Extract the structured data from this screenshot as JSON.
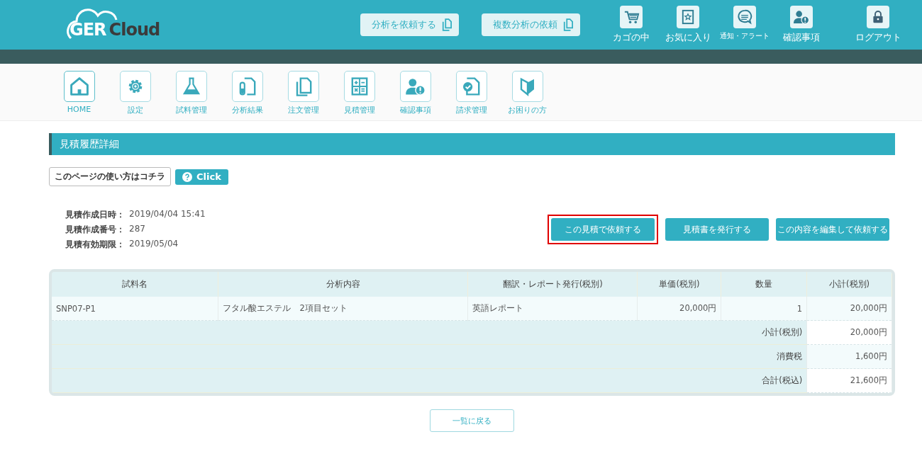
{
  "header": {
    "logo": {
      "text_1": "GER",
      "text_2": "Cloud"
    },
    "action_buttons": [
      "分析を依頼する",
      "複数分析の依頼"
    ],
    "icon_links": [
      {
        "label": "カゴの中",
        "kind": "cart"
      },
      {
        "label": "お気に入り",
        "kind": "star"
      },
      {
        "label": "通知・アラート",
        "kind": "chat"
      },
      {
        "label": "確認事項",
        "kind": "user-alert"
      }
    ],
    "logout": {
      "label": "ログアウト",
      "kind": "lock"
    }
  },
  "nav": [
    {
      "label": "HOME",
      "kind": "home"
    },
    {
      "label": "設定",
      "kind": "gear"
    },
    {
      "label": "試料管理",
      "kind": "flask"
    },
    {
      "label": "分析結果",
      "kind": "tube-doc"
    },
    {
      "label": "注文管理",
      "kind": "docs"
    },
    {
      "label": "見積管理",
      "kind": "calc"
    },
    {
      "label": "確認事項",
      "kind": "user-alert"
    },
    {
      "label": "請求管理",
      "kind": "doc-check"
    },
    {
      "label": "お困りの方",
      "kind": "beginner"
    }
  ],
  "page_title": "見積履歴詳細",
  "help": {
    "label": "このページの使い方はコチラ",
    "button": "Click"
  },
  "info": [
    {
      "label": "見積作成日時：",
      "value": "2019/04/04 15:41"
    },
    {
      "label": "見積作成番号：",
      "value": "287"
    },
    {
      "label": "見積有効期限：",
      "value": "2019/05/04"
    }
  ],
  "actions": [
    {
      "label": "この見積で依頼する",
      "highlighted": true
    },
    {
      "label": "見積書を発行する",
      "highlighted": false
    },
    {
      "label": "この内容を編集して依頼する",
      "highlighted": false
    }
  ],
  "table": {
    "columns": [
      "試料名",
      "分析内容",
      "翻訳・レポート発行(税別)",
      "単価(税別)",
      "数量",
      "小計(税別)"
    ],
    "rows": [
      [
        "SNP07-P1",
        "フタル酸エステル　2項目セット",
        "英語レポート",
        "20,000円",
        "1",
        "20,000円"
      ]
    ],
    "summary": [
      {
        "label": "小計(税別)",
        "value": "20,000円"
      },
      {
        "label": "消費税",
        "value": "1,600円"
      },
      {
        "label": "合計(税込)",
        "value": "21,600円"
      }
    ]
  },
  "back_button": "一覧に戻る"
}
